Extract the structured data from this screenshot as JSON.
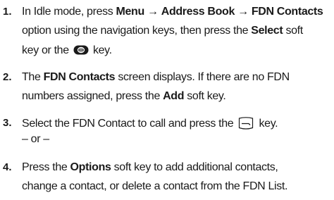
{
  "steps": [
    {
      "number": "1.",
      "line1": {
        "t1": "In Idle mode, press ",
        "b1": "Menu",
        "t2": " → ",
        "b2": "Address Book",
        "t3": " → ",
        "b3": "FDN Contacts"
      },
      "line2": {
        "t1": "option using the navigation keys, then press the ",
        "b1": "Select",
        "t2": " soft"
      },
      "line3": {
        "t1": "key or the ",
        "icon": "media-key-icon",
        "t2": " key."
      }
    },
    {
      "number": "2.",
      "line1": {
        "t1": "The ",
        "b1": "FDN Contacts",
        "t2": " screen displays. If there are no FDN"
      },
      "line2": {
        "t1": "numbers assigned, press the ",
        "b1": "Add",
        "t2": " soft key."
      }
    },
    {
      "number": "3.",
      "line1": {
        "t1": "Select the FDN Contact to call and press the ",
        "icon": "send-key-icon",
        "t2": " key."
      },
      "line2": {
        "t1": "– or –"
      }
    },
    {
      "number": "4.",
      "line1": {
        "t1": "Press the ",
        "b1": "Options",
        "t2": " soft key to add additional contacts,"
      },
      "line2": {
        "t1": "change a contact, or delete a contact from the FDN List."
      }
    }
  ],
  "colors": {
    "text": "#1a1a1a",
    "media_key": "#1a1a1a"
  }
}
